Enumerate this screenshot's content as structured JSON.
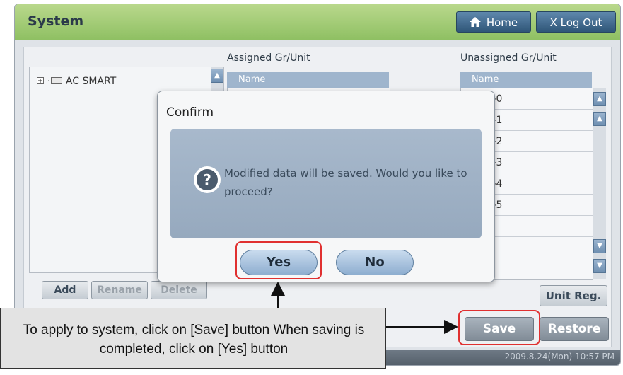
{
  "window": {
    "title": "System"
  },
  "header": {
    "home_label": "Home",
    "logout_label": "X Log Out"
  },
  "icons": {
    "home": "home-icon",
    "question": "question-icon",
    "tree_expand": "tree-expand-icon",
    "folder": "folder-icon",
    "scroll_up": "scroll-up-icon",
    "scroll_top": "scroll-top-icon",
    "scroll_down": "scroll-down-icon",
    "scroll_bottom": "scroll-bottom-icon",
    "arrow": "arrow-icon"
  },
  "tree": {
    "root_label": "AC SMART"
  },
  "assigned": {
    "title": "Assigned Gr/Unit",
    "column": "Name"
  },
  "unassigned": {
    "title": "Unassigned Gr/Unit",
    "column": "Name",
    "rows": [
      "Unit-0",
      "Unit-1",
      "Unit-2",
      "Unit-3",
      "Unit-4",
      "Unit-5"
    ]
  },
  "tree_buttons": {
    "add": "Add",
    "rename": "Rename",
    "delete": "Delete"
  },
  "actions": {
    "unit_reg": "Unit Reg.",
    "save": "Save",
    "restore": "Restore"
  },
  "status": {
    "timestamp": "2009.8.24(Mon) 10:57 PM"
  },
  "dialog": {
    "title": "Confirm",
    "message": "Modified data will be saved.  Would you like to proceed?",
    "yes": "Yes",
    "no": "No"
  },
  "callout": {
    "text": "To apply to system, click on [Save] button When saving is completed, click on [Yes] button"
  },
  "colors": {
    "titlebar": "#8fc063",
    "highlight": "#e03030",
    "button_blue": "#2f5678",
    "dialog_body": "#96a9be"
  }
}
